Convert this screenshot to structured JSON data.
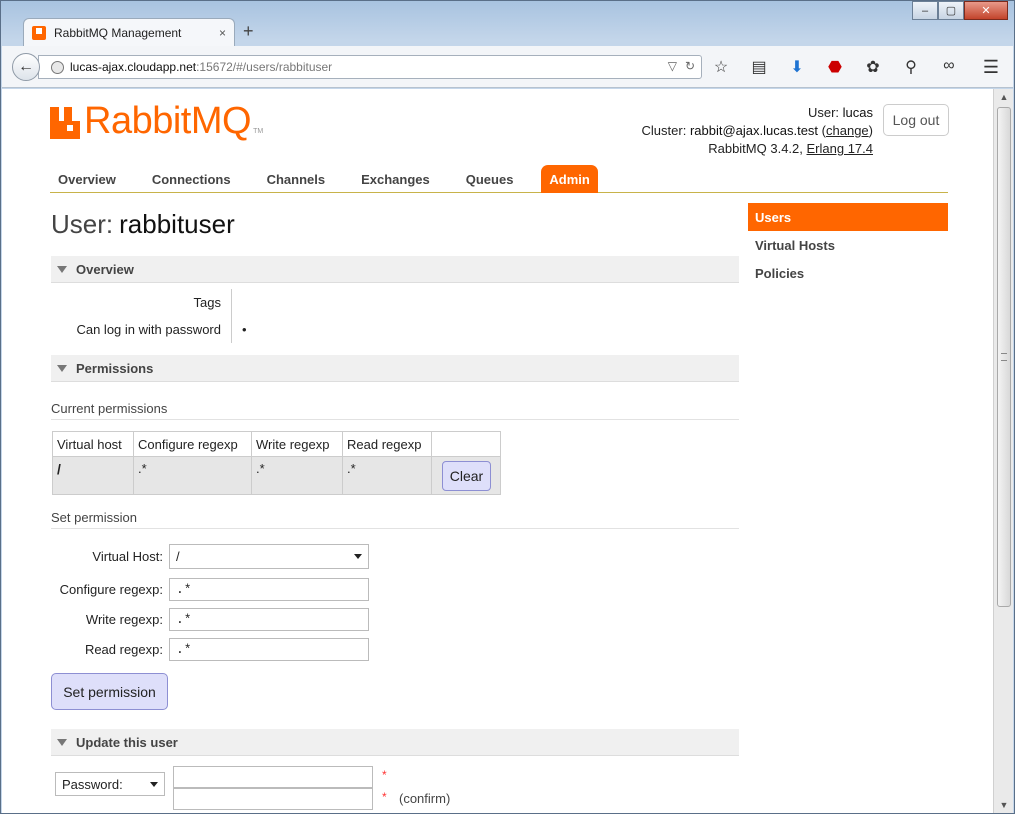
{
  "browser": {
    "tab_title": "RabbitMQ Management",
    "tab_close": "×",
    "new_tab": "+",
    "url_host": "lucas-ajax.cloudapp.net",
    "url_rest": ":15672/#/users/rabbituser",
    "window_buttons": [
      "–",
      "▢",
      "✕"
    ]
  },
  "header": {
    "logo_text": "RabbitMQ",
    "logo_tm": "TM",
    "user_label": "User:",
    "user_value": "lucas",
    "cluster_label": "Cluster:",
    "cluster_value": "rabbit@ajax.lucas.test",
    "cluster_change": "change",
    "version": "RabbitMQ 3.4.2,",
    "erlang": "Erlang 17.4",
    "logout": "Log out"
  },
  "tabs": [
    "Overview",
    "Connections",
    "Channels",
    "Exchanges",
    "Queues",
    "Admin"
  ],
  "active_tab": "Admin",
  "page": {
    "title_prefix": "User:",
    "title_user": "rabbituser"
  },
  "sidebar": {
    "items": [
      "Users",
      "Virtual Hosts",
      "Policies"
    ],
    "active": "Users"
  },
  "overview": {
    "heading": "Overview",
    "rows": [
      {
        "label": "Tags",
        "value": ""
      },
      {
        "label": "Can log in with password",
        "value": "•"
      }
    ]
  },
  "permissions": {
    "heading": "Permissions",
    "current_heading": "Current permissions",
    "columns": [
      "Virtual host",
      "Configure regexp",
      "Write regexp",
      "Read regexp",
      ""
    ],
    "rows": [
      {
        "vhost": "/",
        "configure": ".*",
        "write": ".*",
        "read": ".*",
        "action": "Clear"
      }
    ],
    "set_heading": "Set permission",
    "vhost_label": "Virtual Host:",
    "vhost_value": "/",
    "configure_label": "Configure regexp:",
    "configure_value": ".*",
    "write_label": "Write regexp:",
    "write_value": ".*",
    "read_label": "Read regexp:",
    "read_value": ".*",
    "submit": "Set permission"
  },
  "update": {
    "heading": "Update this user",
    "password_select": "Password:",
    "required_mark": "*",
    "confirm_label": "(confirm)"
  }
}
